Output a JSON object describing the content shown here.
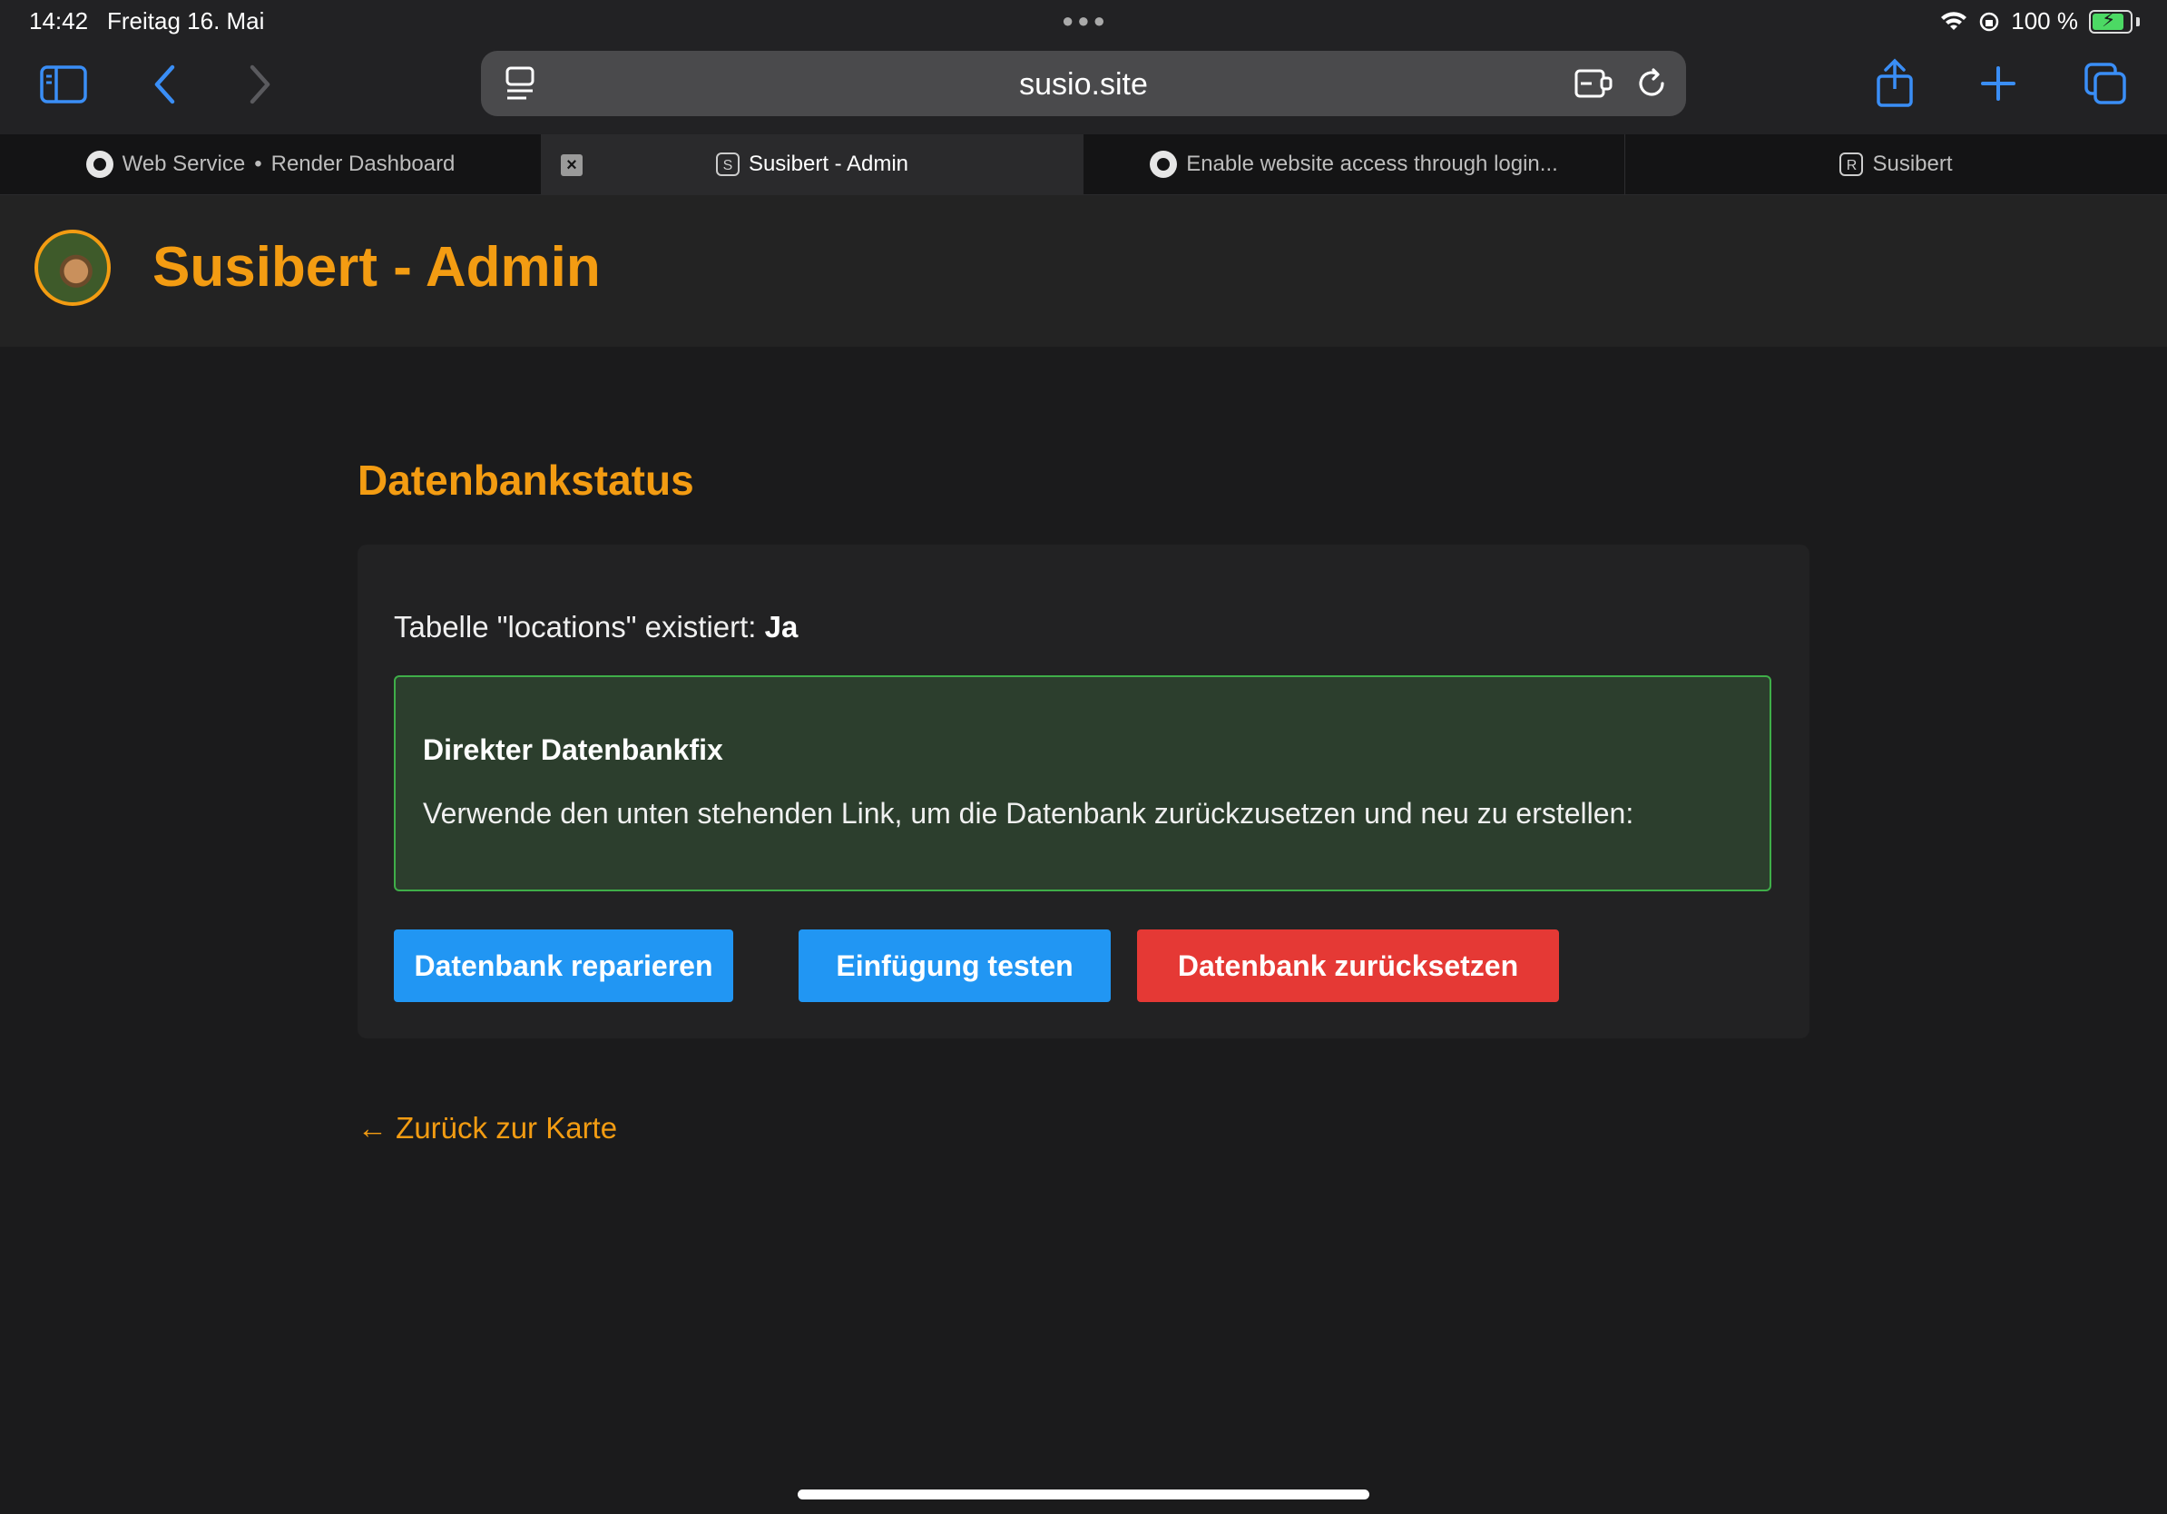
{
  "status_bar": {
    "time": "14:42",
    "date": "Freitag 16. Mai",
    "battery": "100 %"
  },
  "browser": {
    "url": "susio.site",
    "tabs": [
      {
        "label": "Web Service",
        "label2": "Render Dashboard",
        "icon": "github-icon"
      },
      {
        "label": "Susibert - Admin",
        "badge": "S",
        "active": true
      },
      {
        "label": "Enable website access through login...",
        "icon": "github-icon"
      },
      {
        "label": "Susibert",
        "badge": "R"
      }
    ]
  },
  "site": {
    "title": "Susibert - Admin"
  },
  "main": {
    "heading": "Datenbankstatus",
    "table_status_prefix": "Tabelle \"locations\" existiert:",
    "table_status_value": "Ja",
    "notice": {
      "title": "Direkter Datenbankfix",
      "text": "Verwende den unten stehenden Link, um die Datenbank zurückzusetzen und neu zu erstellen:"
    },
    "buttons": {
      "repair": "Datenbank reparieren",
      "test": "Einfügung testen",
      "reset": "Datenbank zurücksetzen"
    },
    "back_link": "← Zurück zur Karte"
  },
  "colors": {
    "accent": "#f39c12",
    "primary_button": "#2196f3",
    "danger_button": "#e53935",
    "notice_border": "#3fae49"
  }
}
